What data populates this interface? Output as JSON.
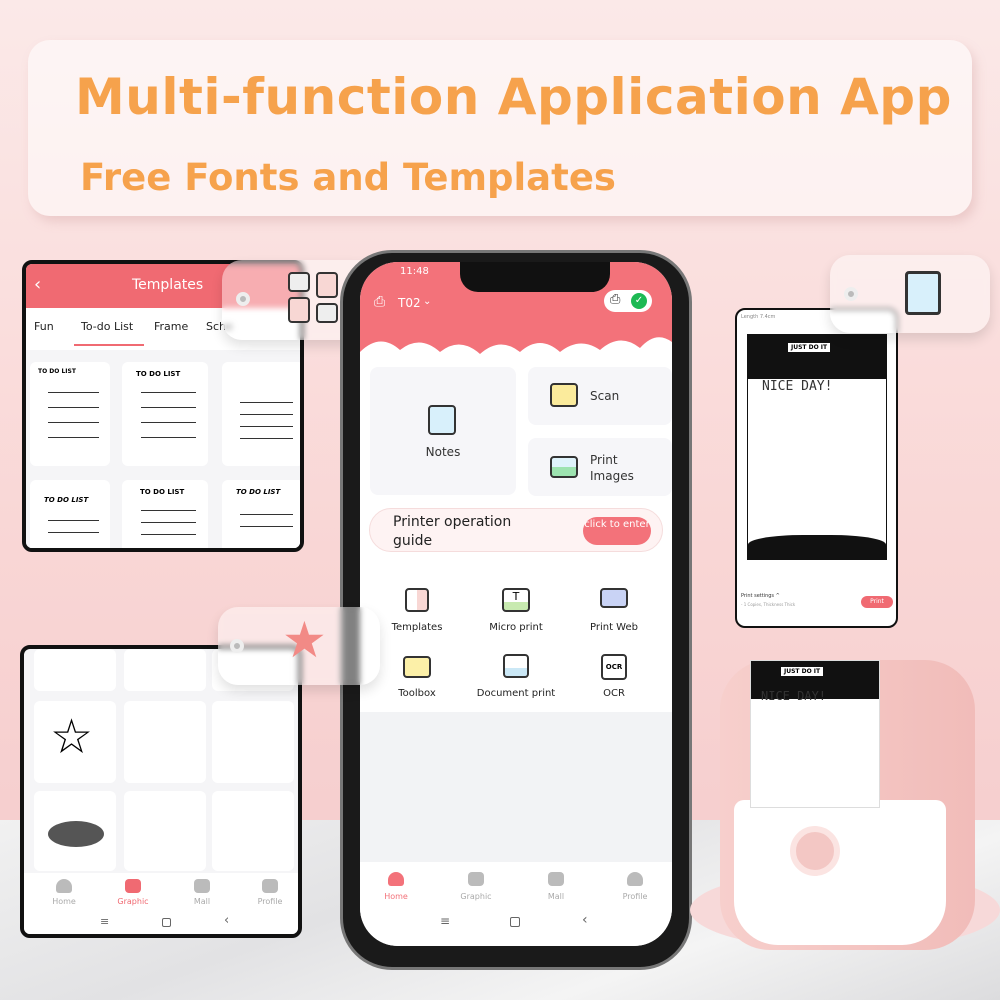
{
  "banner": {
    "title": "Multi-function Application App",
    "subtitle": "Free Fonts and Templates"
  },
  "templates_panel": {
    "title": "Templates",
    "tabs": [
      "Fun",
      "To-do List",
      "Frame",
      "Sche"
    ],
    "active_tab": "To-do List",
    "thumb_label": "TO DO LIST",
    "accent": "#f06a72"
  },
  "phone": {
    "status_time": "11:48",
    "device": "T02",
    "cards": {
      "notes": "Notes",
      "scan": "Scan",
      "print_images": "Print Images"
    },
    "guide": {
      "text": "Printer operation guide",
      "button": "click to enter"
    },
    "tools": [
      {
        "label": "Templates",
        "icon": "templates-icon"
      },
      {
        "label": "Micro print",
        "icon": "micro-print-icon"
      },
      {
        "label": "Print Web",
        "icon": "monitor-icon"
      },
      {
        "label": "Toolbox",
        "icon": "toolbox-icon"
      },
      {
        "label": "Document print",
        "icon": "document-icon"
      },
      {
        "label": "OCR",
        "icon": "ocr-icon"
      }
    ],
    "ocr_glyph": "OCR",
    "tabbar": [
      "Home",
      "Graphic",
      "Mall",
      "Profile"
    ],
    "active_tab": "Home"
  },
  "print_preview": {
    "length": "Length 7.4cm",
    "banner_text": "JUST DO IT",
    "headline": "NICE DAY!",
    "settings": "Print settings ^",
    "settings_detail": "- 1 Copies, Thickness Thick",
    "print_button": "Print"
  },
  "graphic_panel": {
    "tabbar": [
      "Home",
      "Graphic",
      "Mall",
      "Profile"
    ],
    "active_tab": "Graphic"
  },
  "printer": {
    "paper_text": "NICE DAY!",
    "paper_banner": "JUST DO IT"
  },
  "colors": {
    "accent": "#f06a72",
    "title": "#f6a24c",
    "printer": "#f4c6c4"
  }
}
